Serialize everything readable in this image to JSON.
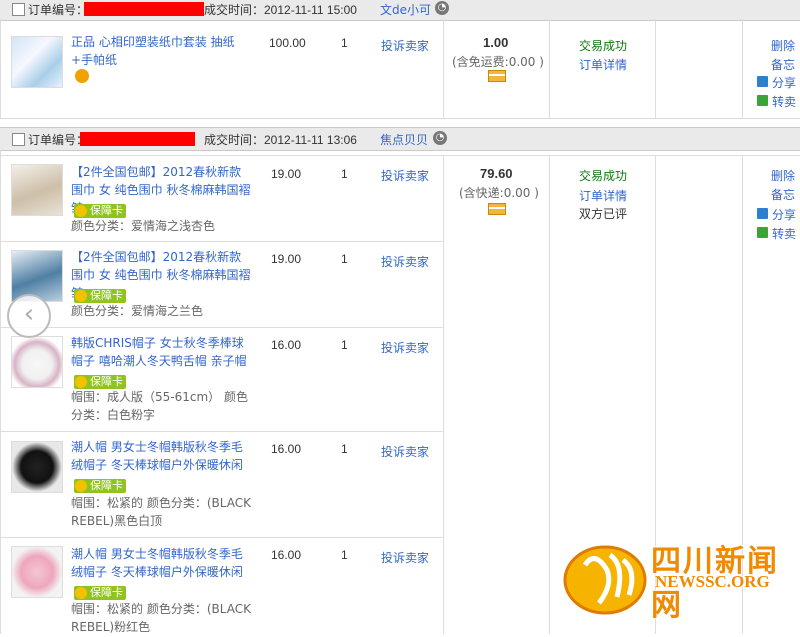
{
  "order1": {
    "label": "订单编号：",
    "time": "成交时间：2012-11-11 15:00",
    "seller": "文de小可",
    "item": {
      "title": "正品 心相印塑装纸巾套装 抽纸+手帕纸",
      "price": "100.00",
      "qty": "1",
      "complain": "投诉卖家"
    },
    "total": "1.00",
    "shipping": "(含免运费:0.00 )",
    "status": "交易成功",
    "detail": "订单详情",
    "delete": "删除",
    "note": "备忘",
    "share": "分享",
    "resell": "转卖"
  },
  "order2": {
    "label": "订单编号：",
    "time": "成交时间：2012-11-11 13:06",
    "seller": "焦点贝贝",
    "total": "79.60",
    "shipping": "(含快递:0.00 )",
    "status": "交易成功",
    "detail": "订单详情",
    "rated": "双方已评",
    "delete": "删除",
    "note": "备忘",
    "share": "分享",
    "resell": "转卖",
    "badge": "保障卡",
    "items": [
      {
        "title": "【2件全国包邮】2012春秋新款围巾 女 纯色围巾 秋冬棉麻韩国褶皱",
        "attr": "颜色分类：爱情海之浅杏色",
        "price": "19.00",
        "qty": "1",
        "complain": "投诉卖家"
      },
      {
        "title": "【2件全国包邮】2012春秋新款围巾 女 纯色围巾 秋冬棉麻韩国褶皱",
        "attr": "颜色分类：爱情海之兰色",
        "price": "19.00",
        "qty": "1",
        "complain": "投诉卖家"
      },
      {
        "title": "韩版CHRIS帽子 女士秋冬季棒球帽子 嘻哈潮人冬天鸭舌帽 亲子帽",
        "attr": "帽围：成人版（55-61cm） 颜色分类：白色粉字",
        "price": "16.00",
        "qty": "1",
        "complain": "投诉卖家"
      },
      {
        "title": "潮人帽 男女士冬帽韩版秋冬季毛绒帽子 冬天棒球帽户外保暖休闲",
        "attr": "帽围：松紧的 颜色分类：(BLACK REBEL)黑色白顶",
        "price": "16.00",
        "qty": "1",
        "complain": "投诉卖家"
      },
      {
        "title": "潮人帽 男女士冬帽韩版秋冬季毛绒帽子 冬天棒球帽户外保暖休闲",
        "attr": "帽围：松紧的 颜色分类：(BLACK REBEL)粉红色",
        "price": "16.00",
        "qty": "1",
        "complain": "投诉卖家"
      }
    ]
  },
  "watermark": {
    "cn": "四川新闻网",
    "en": "NEWSSC.ORG"
  },
  "colors": {
    "link": "#3366cc",
    "status_green": "#0a7a0a",
    "badge_green": "#8fc31f",
    "redact": "#ff0000",
    "watermark_orange": "#f08a00"
  }
}
